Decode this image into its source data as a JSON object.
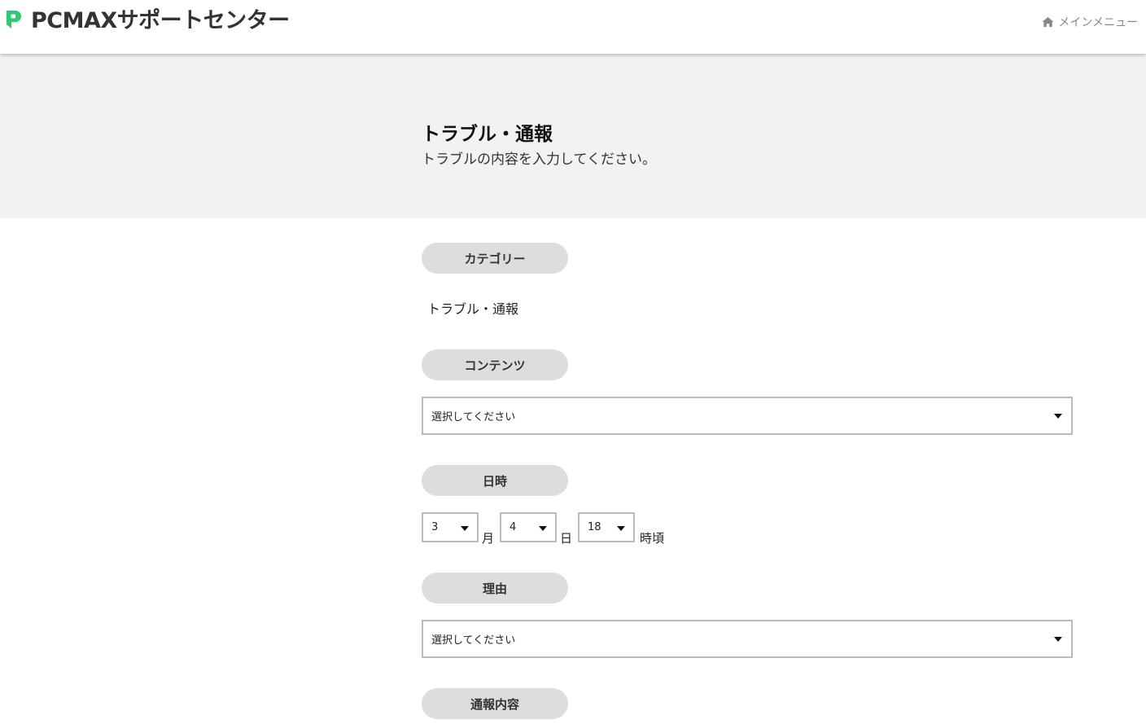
{
  "header": {
    "site_title": "PCMAXサポートセンター",
    "main_menu_label": "メインメニュー",
    "brand_color": "#2ecc71",
    "logo_icon": "p-logo-icon",
    "home_icon": "home-icon"
  },
  "hero": {
    "title": "トラブル・通報",
    "subtitle": "トラブルの内容を入力してください。"
  },
  "form": {
    "category": {
      "label": "カテゴリー",
      "value": "トラブル・通報"
    },
    "contents": {
      "label": "コンテンツ",
      "selected": "選択してください"
    },
    "datetime": {
      "label": "日時",
      "month": "3",
      "month_unit": "月",
      "day": "4",
      "day_unit": "日",
      "hour": "18",
      "hour_unit": "時頃"
    },
    "reason": {
      "label": "理由",
      "selected": "選択してください"
    },
    "report": {
      "label": "通報内容"
    }
  }
}
